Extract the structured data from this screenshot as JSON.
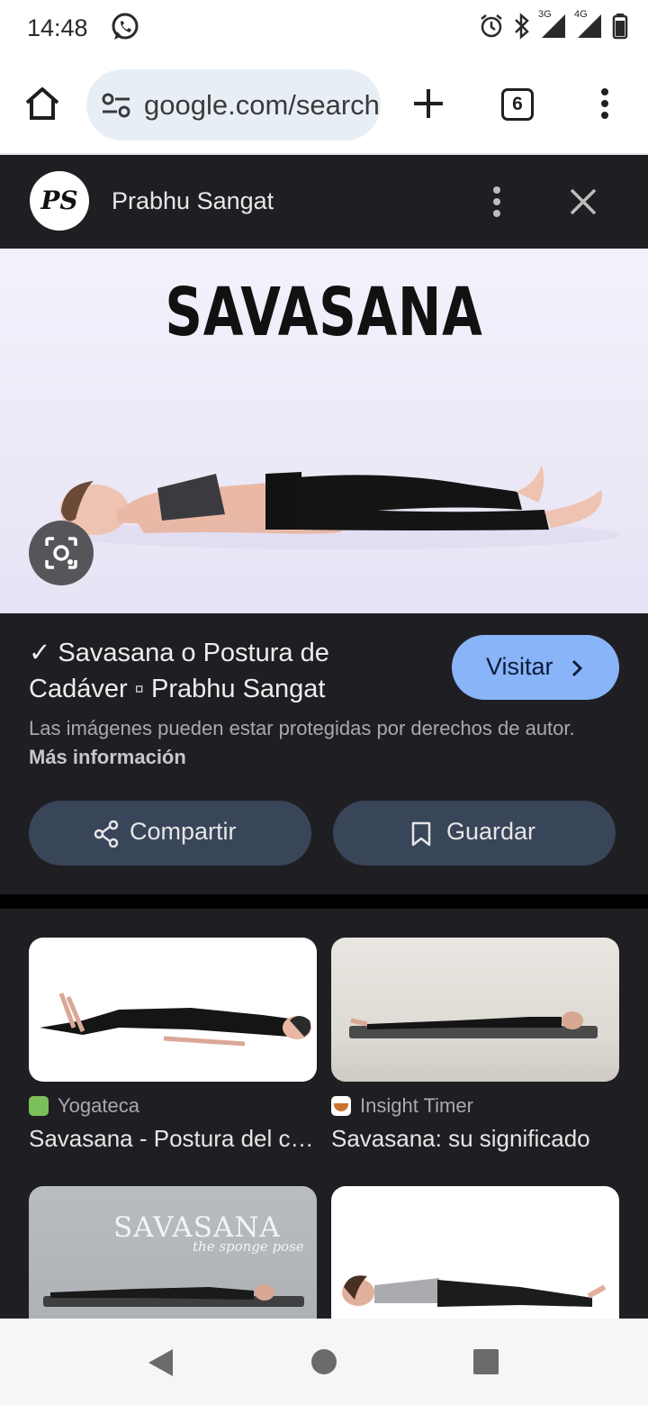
{
  "status_bar": {
    "time": "14:48",
    "net1": "3G",
    "net2": "4G"
  },
  "browser": {
    "url": "google.com/search",
    "tab_count": "6"
  },
  "panel": {
    "source_logo": "PS",
    "source_name": "Prabhu Sangat",
    "hero_title": "SAVASANA",
    "result_title": "✓ Savasana o Postura de Cadáver ▫ Prabhu Sangat",
    "visit_label": "Visitar",
    "copyright_text": "Las imágenes pueden estar protegidas por derechos de autor.",
    "more_info_label": "Más información",
    "share_label": "Compartir",
    "save_label": "Guardar"
  },
  "related": [
    {
      "source": "Yogateca",
      "caption": "Savasana - Postura del cadáver"
    },
    {
      "source": "Insight Timer",
      "caption": "Savasana: su significado"
    },
    {
      "thumb_title": "SAVASANA",
      "thumb_subtitle": "the sponge pose"
    },
    {}
  ],
  "colors": {
    "accent_button": "#8ab4f8",
    "panel_bg": "#1f1f23",
    "chip_bg": "#394559"
  }
}
